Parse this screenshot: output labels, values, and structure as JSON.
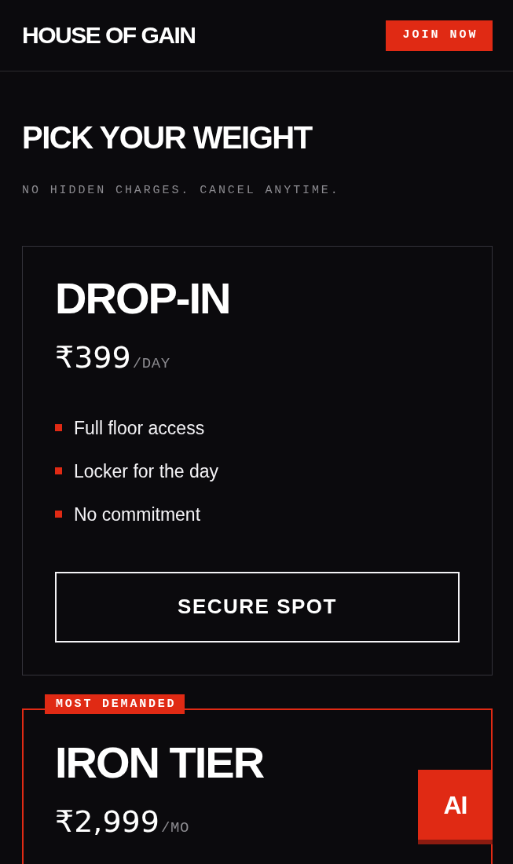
{
  "header": {
    "logo": "HOUSE OF GAIN",
    "join_button": "JOIN NOW"
  },
  "section": {
    "title": "PICK YOUR WEIGHT",
    "subtitle": "NO HIDDEN CHARGES. CANCEL ANYTIME."
  },
  "plans": [
    {
      "featured": false,
      "name": "DROP-IN",
      "price": "₹399",
      "period": "/DAY",
      "features": [
        "Full floor access",
        "Locker for the day",
        "No commitment"
      ],
      "button": "SECURE SPOT"
    },
    {
      "featured": true,
      "badge": "MOST DEMANDED",
      "name": "IRON TIER",
      "price": "₹2,999",
      "period": "/MO"
    }
  ],
  "ai_button": {
    "label": "AI"
  }
}
